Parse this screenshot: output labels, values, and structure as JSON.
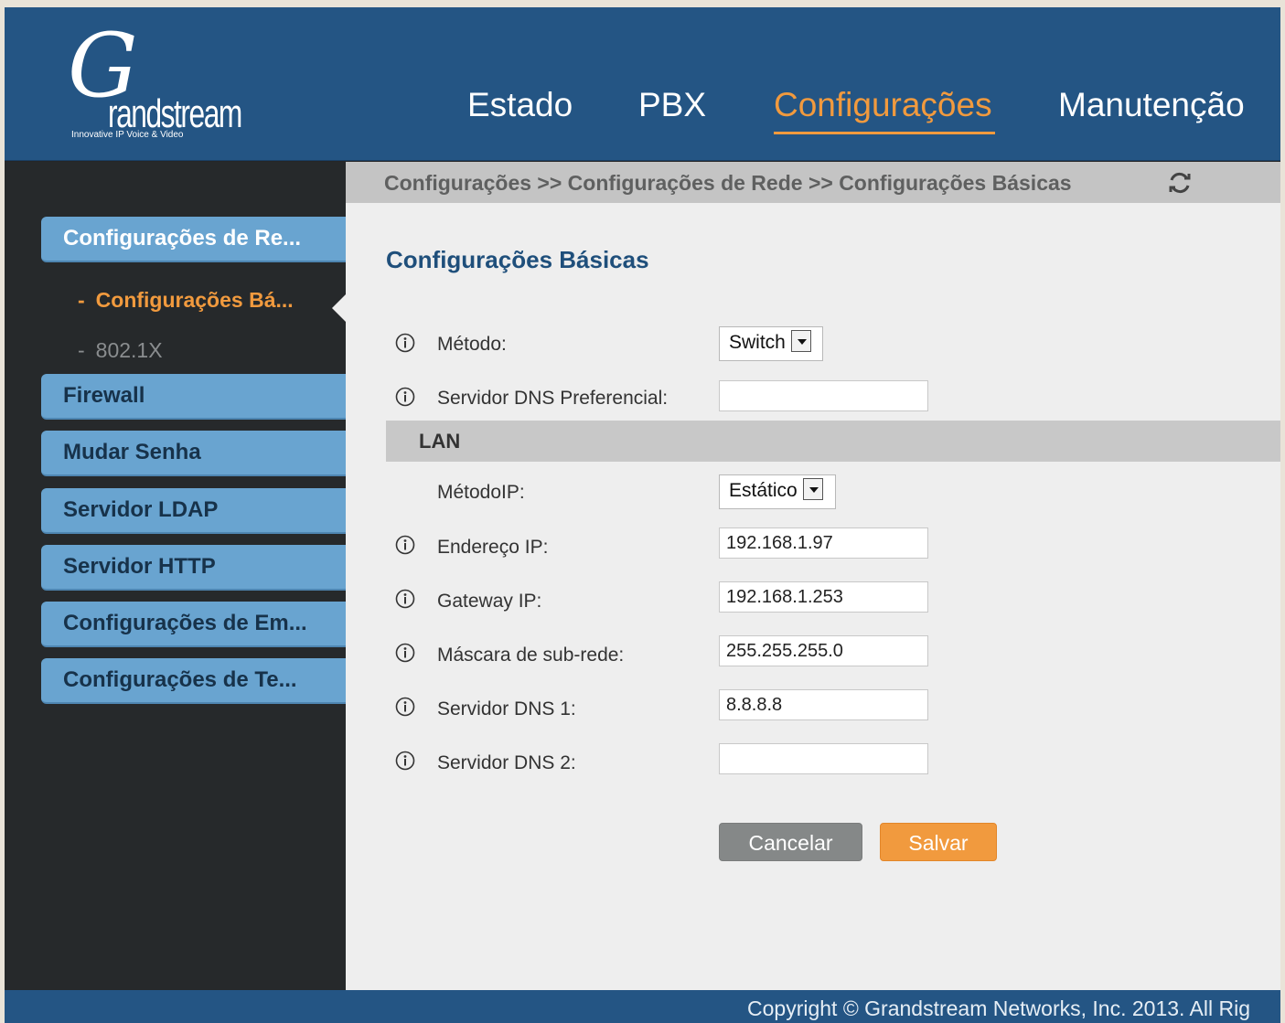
{
  "logo": {
    "script_letter": "G",
    "wordmark": "randstream",
    "tagline": "Innovative IP Voice & Video"
  },
  "topnav": {
    "items": [
      {
        "label": "Estado"
      },
      {
        "label": "PBX"
      },
      {
        "label": "Configurações",
        "active": true
      },
      {
        "label": "Manutenção"
      }
    ]
  },
  "sidebar": {
    "items": [
      {
        "label": "Configurações de Re...",
        "open": true
      },
      {
        "label": "Firewall"
      },
      {
        "label": "Mudar Senha"
      },
      {
        "label": "Servidor LDAP"
      },
      {
        "label": "Servidor HTTP"
      },
      {
        "label": "Configurações de Em..."
      },
      {
        "label": "Configurações de Te..."
      }
    ],
    "subitems": [
      {
        "dash": "-",
        "label": "Configurações Bá...",
        "active": true
      },
      {
        "dash": "-",
        "label": "802.1X"
      }
    ]
  },
  "breadcrumb": "Configurações >> Configurações de Rede >> Configurações Básicas",
  "page_title": "Configurações Básicas",
  "form": {
    "metodo": {
      "label": "Método:",
      "value": "Switch"
    },
    "dns_preferencial": {
      "label": "Servidor DNS Preferencial:",
      "value": ""
    },
    "lan_section": "LAN",
    "metodo_ip": {
      "label": "MétodoIP:",
      "value": "Estático"
    },
    "endereco_ip": {
      "label": "Endereço IP:",
      "value": "192.168.1.97"
    },
    "gateway_ip": {
      "label": "Gateway IP:",
      "value": "192.168.1.253"
    },
    "mascara": {
      "label": "Máscara de sub-rede:",
      "value": "255.255.255.0"
    },
    "dns1": {
      "label": "Servidor DNS 1:",
      "value": "8.8.8.8"
    },
    "dns2": {
      "label": "Servidor DNS 2:",
      "value": ""
    }
  },
  "buttons": {
    "cancel": "Cancelar",
    "save": "Salvar"
  },
  "footer": {
    "copyright": "Copyright © Grandstream Networks, Inc. 2013. All Rig"
  },
  "colors": {
    "header_bg": "#245584",
    "accent": "#f19a3e",
    "sidebar_item_bg": "#69a4d0",
    "title_blue": "#1f4f7b"
  },
  "icons": {
    "info": "info-icon",
    "refresh": "refresh-icon",
    "dropdown": "chevron-down-icon"
  }
}
